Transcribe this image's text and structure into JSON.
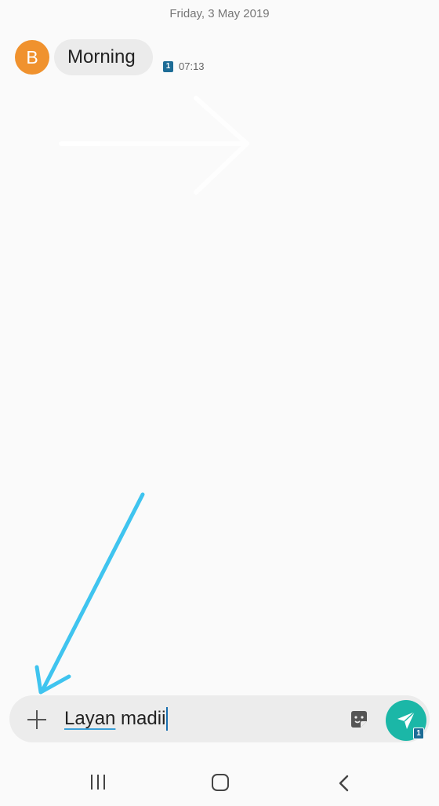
{
  "conversation": {
    "date_header": "Friday, 3 May 2019",
    "messages": [
      {
        "avatar_initial": "B",
        "avatar_color": "#f0922e",
        "text": "Morning",
        "sim_label": "1",
        "time": "07:13"
      }
    ]
  },
  "composer": {
    "attach_icon": "plus-icon",
    "input_value_underlined": "Layan",
    "input_value_rest": " madii",
    "sticker_icon": "sticker-icon",
    "send_icon": "send-icon",
    "send_sim_label": "1",
    "accent_color": "#1bb7a7"
  },
  "navbar": {
    "items": [
      {
        "icon": "recent-apps-icon"
      },
      {
        "icon": "home-icon"
      },
      {
        "icon": "back-icon"
      }
    ]
  },
  "annotation": {
    "arrow_color": "#3fc4ef"
  }
}
